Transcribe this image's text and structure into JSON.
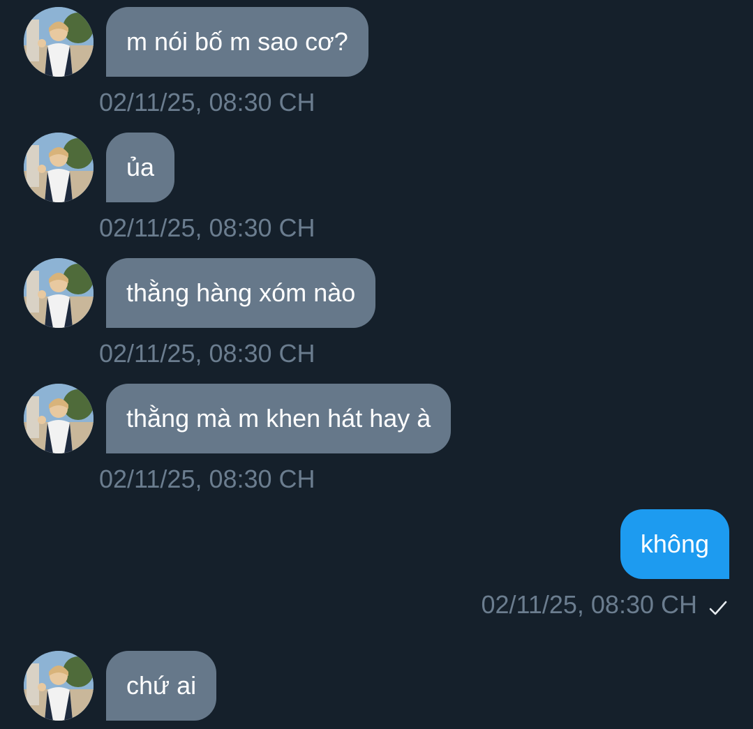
{
  "colors": {
    "background": "#15202b",
    "incoming_bubble": "#66788a",
    "outgoing_bubble": "#1d9bf0",
    "timestamp": "#6b7d8f"
  },
  "messages": [
    {
      "direction": "incoming",
      "text": "m nói bố m sao cơ?",
      "time": "02/11/25, 08:30 CH"
    },
    {
      "direction": "incoming",
      "text": "ủa",
      "time": "02/11/25, 08:30 CH"
    },
    {
      "direction": "incoming",
      "text": "thằng hàng xóm nào",
      "time": "02/11/25, 08:30 CH"
    },
    {
      "direction": "incoming",
      "text": "thằng mà m khen hát hay à",
      "time": "02/11/25, 08:30 CH"
    },
    {
      "direction": "outgoing",
      "text": "không",
      "time": "02/11/25, 08:30 CH",
      "status_icon": "check-icon"
    },
    {
      "direction": "incoming",
      "text": "chứ ai"
    }
  ]
}
